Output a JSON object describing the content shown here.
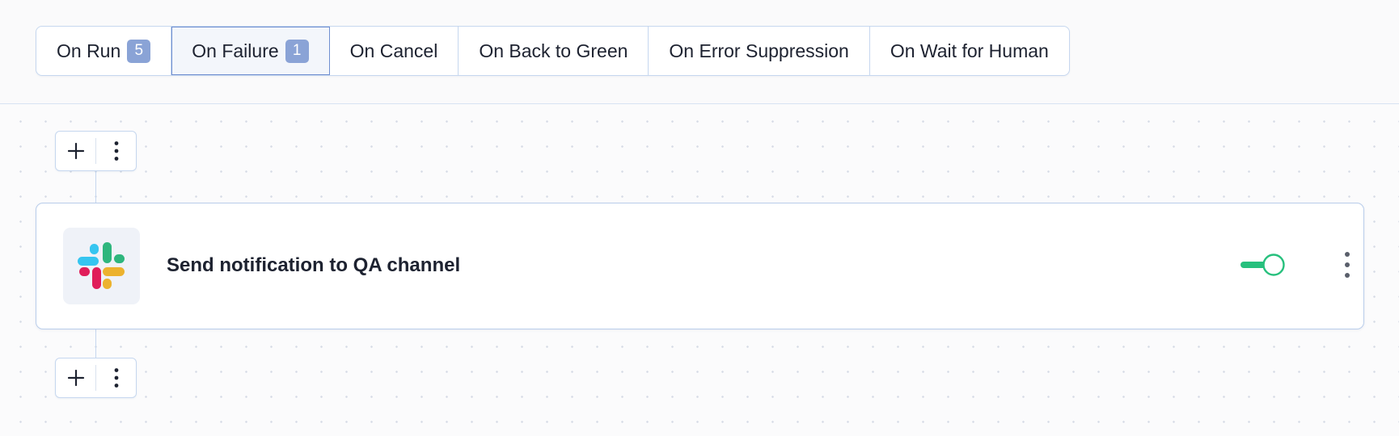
{
  "trigger_tabs": [
    {
      "label": "On Run",
      "badge": "5",
      "active": false
    },
    {
      "label": "On Failure",
      "badge": "1",
      "active": true
    },
    {
      "label": "On Cancel",
      "badge": null,
      "active": false
    },
    {
      "label": "On Back to Green",
      "badge": null,
      "active": false
    },
    {
      "label": "On Error Suppression",
      "badge": null,
      "active": false
    },
    {
      "label": "On Wait for Human",
      "badge": null,
      "active": false
    }
  ],
  "toolbar": {
    "add_icon": "plus-icon",
    "menu_icon": "more-vertical-icon"
  },
  "action_card": {
    "title": "Send notification to QA channel",
    "logo_icon": "slack-logo",
    "enabled": true,
    "menu_icon": "more-vertical-icon"
  },
  "colors": {
    "accent_border": "#6f8ed0",
    "badge_bg": "#8aa3d6",
    "toggle_green": "#27c07d",
    "slack_blue": "#36c5f0",
    "slack_green": "#2eb67d",
    "slack_red": "#e01e5a",
    "slack_yellow": "#ecb22e"
  }
}
